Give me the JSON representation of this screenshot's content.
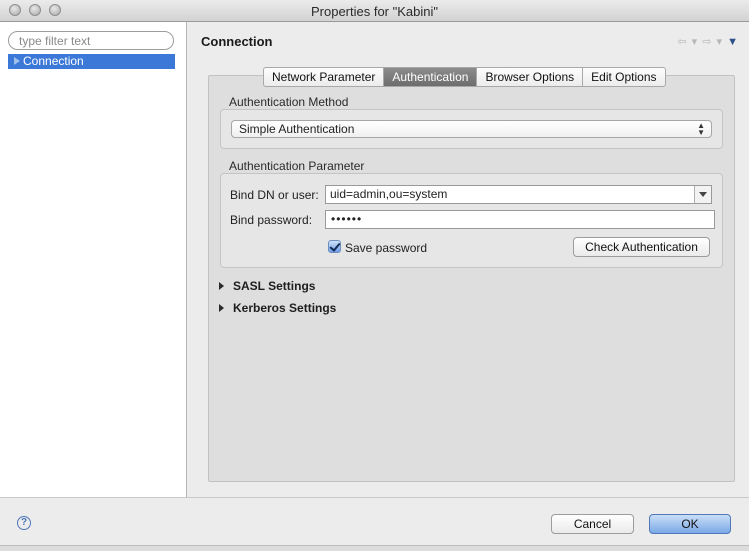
{
  "window": {
    "title": "Properties for \"Kabini\""
  },
  "sidebar": {
    "filter_placeholder": "type filter text",
    "items": [
      {
        "label": "Connection",
        "selected": true
      }
    ]
  },
  "page": {
    "title": "Connection",
    "nav": {
      "back_icon": "back-arrow-icon",
      "forward_icon": "forward-arrow-icon",
      "menu_icon": "view-menu-icon"
    }
  },
  "tabs": [
    {
      "label": "Network Parameter",
      "active": false
    },
    {
      "label": "Authentication",
      "active": true
    },
    {
      "label": "Browser Options",
      "active": false
    },
    {
      "label": "Edit Options",
      "active": false
    }
  ],
  "auth_method": {
    "group_label": "Authentication Method",
    "selected": "Simple Authentication"
  },
  "auth_param": {
    "group_label": "Authentication Parameter",
    "bind_dn_label": "Bind DN or user:",
    "bind_dn_value": "uid=admin,ou=system",
    "bind_password_label": "Bind password:",
    "bind_password_value": "••••••",
    "save_password_label": "Save password",
    "save_password_checked": true,
    "check_button": "Check Authentication"
  },
  "sections": [
    {
      "label": "SASL Settings",
      "expanded": false
    },
    {
      "label": "Kerberos Settings",
      "expanded": false
    }
  ],
  "footer": {
    "help_icon": "help-icon",
    "help_glyph": "?",
    "cancel": "Cancel",
    "ok": "OK"
  },
  "colors": {
    "selection": "#3c78d8",
    "active_tab": "#7a7a7a",
    "default_button": "#7ba8e6"
  }
}
